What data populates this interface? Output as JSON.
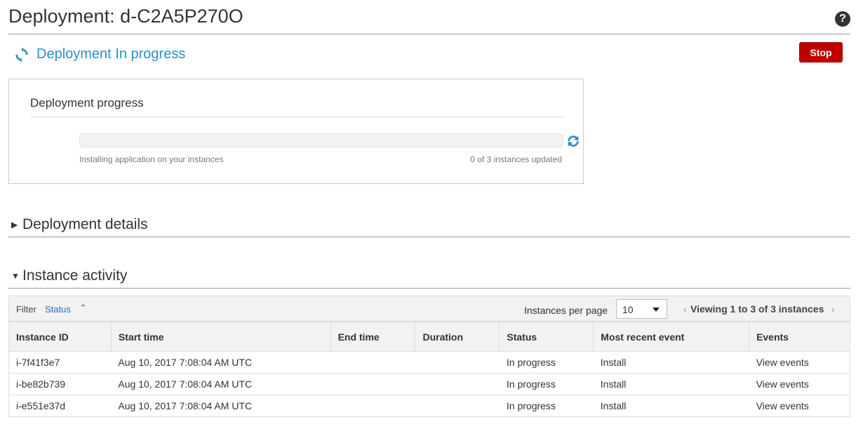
{
  "header": {
    "title": "Deployment: d-C2A5P270O",
    "help_glyph": "?"
  },
  "status": {
    "text": "Deployment In progress",
    "icon": "refresh-icon",
    "color": "#2e8ccb"
  },
  "actions": {
    "stop_label": "Stop",
    "stop_color": "#c00000"
  },
  "progress": {
    "title": "Deployment progress",
    "left_label": "Installing application on your instances",
    "right_label": "0 of 3 instances updated",
    "fraction": 0
  },
  "sections": {
    "details": {
      "caret": "▶",
      "label": "Deployment details"
    },
    "activity": {
      "caret": "▼",
      "label": "Instance activity"
    }
  },
  "filter": {
    "label": "Filter",
    "value": "Status",
    "caret": "⌃"
  },
  "pagination": {
    "per_page_label": "Instances per page",
    "per_page_value": "10",
    "prev": "‹",
    "viewing_text": "Viewing 1 to 3 of 3 instances",
    "next": "›"
  },
  "table": {
    "columns": [
      "Instance ID",
      "Start time",
      "End time",
      "Duration",
      "Status",
      "Most recent event",
      "Events"
    ],
    "rows": [
      {
        "id": "i-7f41f3e7",
        "start": "Aug 10, 2017 7:08:04 AM UTC",
        "end": "",
        "duration": "",
        "status": "In progress",
        "event": "Install",
        "events_link": "View events"
      },
      {
        "id": "i-be82b739",
        "start": "Aug 10, 2017 7:08:04 AM UTC",
        "end": "",
        "duration": "",
        "status": "In progress",
        "event": "Install",
        "events_link": "View events"
      },
      {
        "id": "i-e551e37d",
        "start": "Aug 10, 2017 7:08:04 AM UTC",
        "end": "",
        "duration": "",
        "status": "In progress",
        "event": "Install",
        "events_link": "View events"
      }
    ]
  }
}
